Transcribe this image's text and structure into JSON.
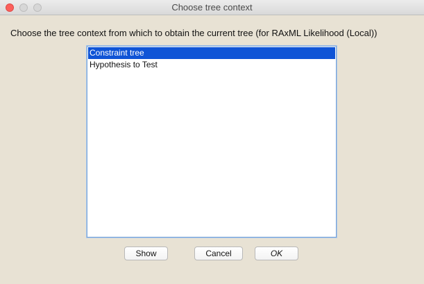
{
  "window": {
    "title": "Choose tree context"
  },
  "dialog": {
    "prompt": "Choose the tree context from which to obtain the current tree (for RAxML Likelihood (Local))",
    "list": {
      "items": [
        {
          "label": "Constraint tree",
          "selected": true
        },
        {
          "label": "Hypothesis to Test",
          "selected": false
        }
      ]
    },
    "buttons": {
      "show": "Show",
      "cancel": "Cancel",
      "ok": "OK"
    }
  },
  "colors": {
    "background": "#e8e2d4",
    "selection": "#0f54d6",
    "close_button": "#fc605c"
  }
}
